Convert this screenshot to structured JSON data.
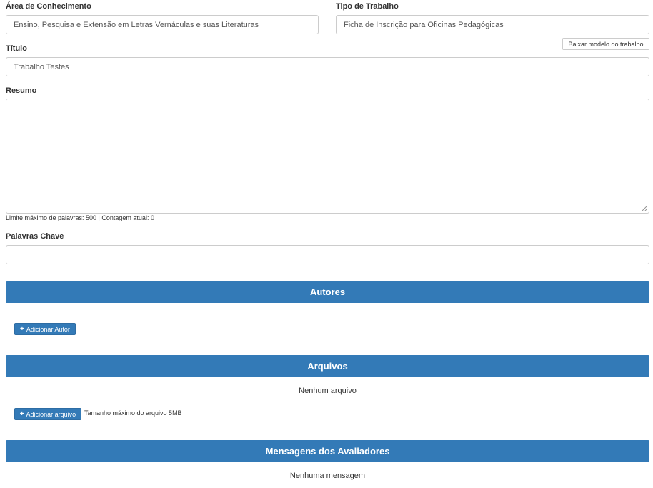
{
  "form": {
    "area": {
      "label": "Área de Conhecimento",
      "value": "Ensino, Pesquisa e Extensão em Letras Vernáculas e suas Literaturas"
    },
    "tipo": {
      "label": "Tipo de Trabalho",
      "value": "Ficha de Inscrição para Oficinas Pedagógicas"
    },
    "download_button": "Baixar modelo do trabalho",
    "titulo": {
      "label": "Título",
      "value": "Trabalho Testes"
    },
    "resumo": {
      "label": "Resumo",
      "value": "",
      "hint": "Limite máximo de palavras: 500 | Contagem atual: 0"
    },
    "palavras": {
      "label": "Palavras Chave",
      "value": ""
    }
  },
  "autores": {
    "title": "Autores",
    "add_button": "Adicionar Autor"
  },
  "arquivos": {
    "title": "Arquivos",
    "empty": "Nenhum arquivo",
    "add_button": "Adicionar arquivo",
    "size_hint": "Tamanho máximo do arquivo 5MB"
  },
  "mensagens": {
    "title": "Mensagens dos Avaliadores",
    "empty": "Nenhuma mensagem"
  },
  "icons": {
    "plus": "+"
  },
  "colors": {
    "primary": "#337ab7"
  }
}
